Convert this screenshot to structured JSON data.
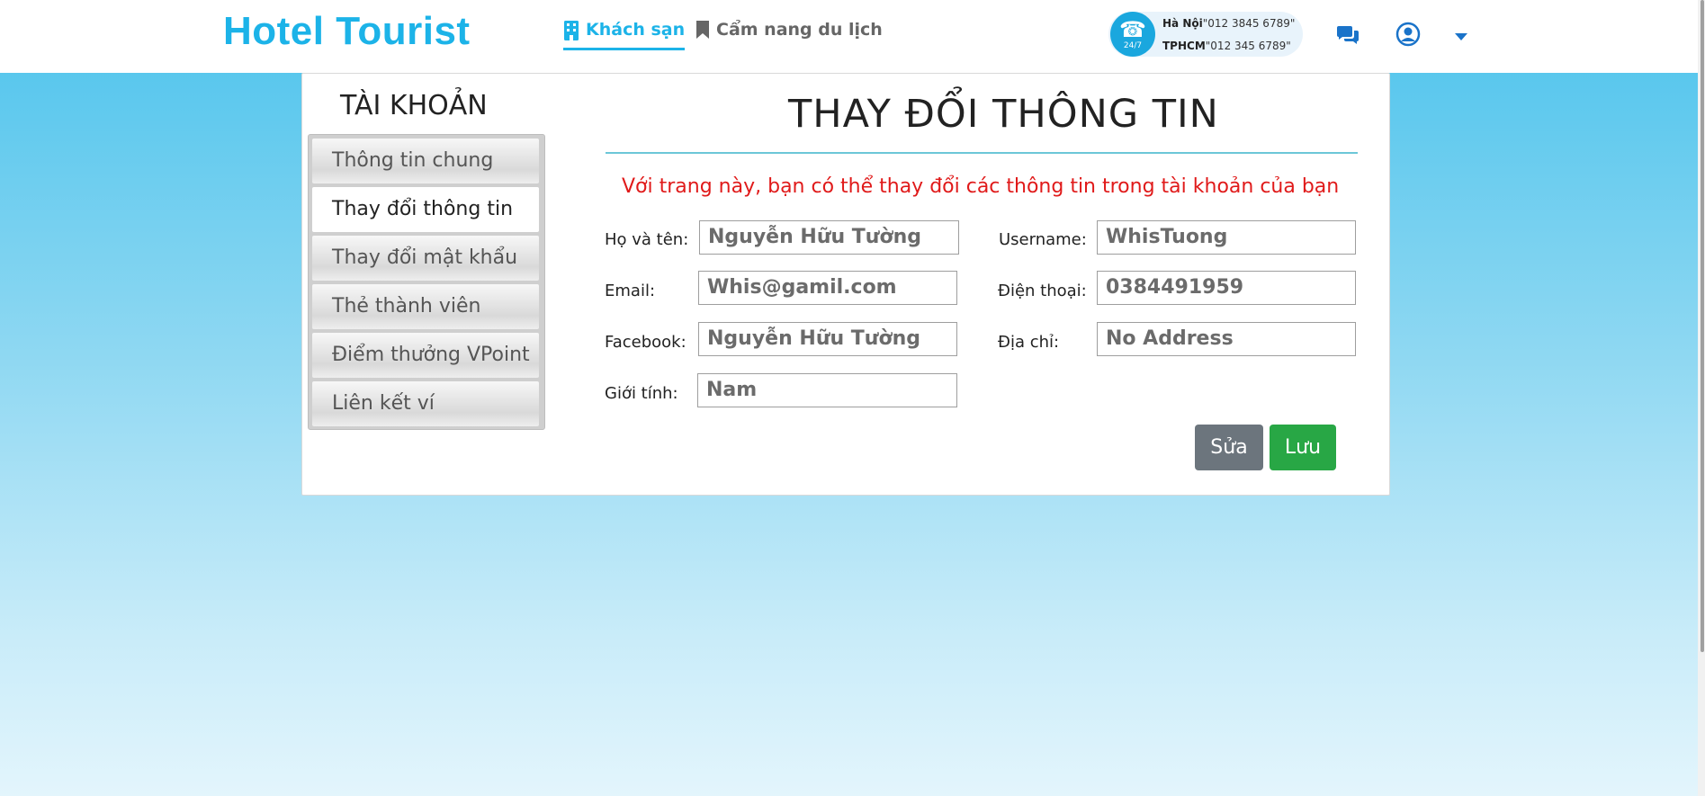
{
  "header": {
    "logo": "Hotel Tourist",
    "nav": [
      {
        "label": "Khách sạn",
        "icon": "building-icon",
        "active": true
      },
      {
        "label": "Cẩm nang du lịch",
        "icon": "bookmark-icon",
        "active": false
      }
    ],
    "hotline": {
      "badge": "24/7",
      "lines": [
        {
          "city": "Hà Nội",
          "phone": "\"012 3845 6789\""
        },
        {
          "city": "TPHCM",
          "phone": "\"012 345 6789\""
        }
      ]
    },
    "icons": [
      "chat-icon",
      "user-icon",
      "caret-down-icon"
    ]
  },
  "sidebar": {
    "title": "TÀI KHOẢN",
    "items": [
      {
        "label": "Thông tin chung",
        "active": false
      },
      {
        "label": "Thay đổi thông tin",
        "active": true
      },
      {
        "label": "Thay đổi mật khẩu",
        "active": false
      },
      {
        "label": "Thẻ thành viên",
        "active": false
      },
      {
        "label": "Điểm thưởng VPoint",
        "active": false
      },
      {
        "label": "Liên kết ví",
        "active": false
      }
    ]
  },
  "form": {
    "title": "THAY ĐỔI THÔNG TIN",
    "intro": "Với trang này, bạn có thể thay đổi các thông tin trong tài khoản của bạn",
    "fields": {
      "fullname": {
        "label": "Họ và tên:",
        "value": "Nguyễn Hữu Tường"
      },
      "username": {
        "label": "Username:",
        "value": "WhisTuong"
      },
      "email": {
        "label": "Email:",
        "value": "Whis@gamil.com"
      },
      "phone": {
        "label": "Điện thoại:",
        "value": "0384491959"
      },
      "facebook": {
        "label": "Facebook:",
        "value": "Nguyễn Hữu Tường"
      },
      "address": {
        "label": "Địa chỉ:",
        "value": "No Address"
      },
      "gender": {
        "label": "Giới tính:",
        "value": "Nam"
      }
    },
    "buttons": {
      "edit": "Sửa",
      "save": "Lưu"
    }
  },
  "colors": {
    "brand": "#1cb3e8",
    "intro_text": "#e01a1a",
    "edit_button": "#6c757d",
    "save_button": "#28a745",
    "background_top": "#4cc3ec"
  }
}
